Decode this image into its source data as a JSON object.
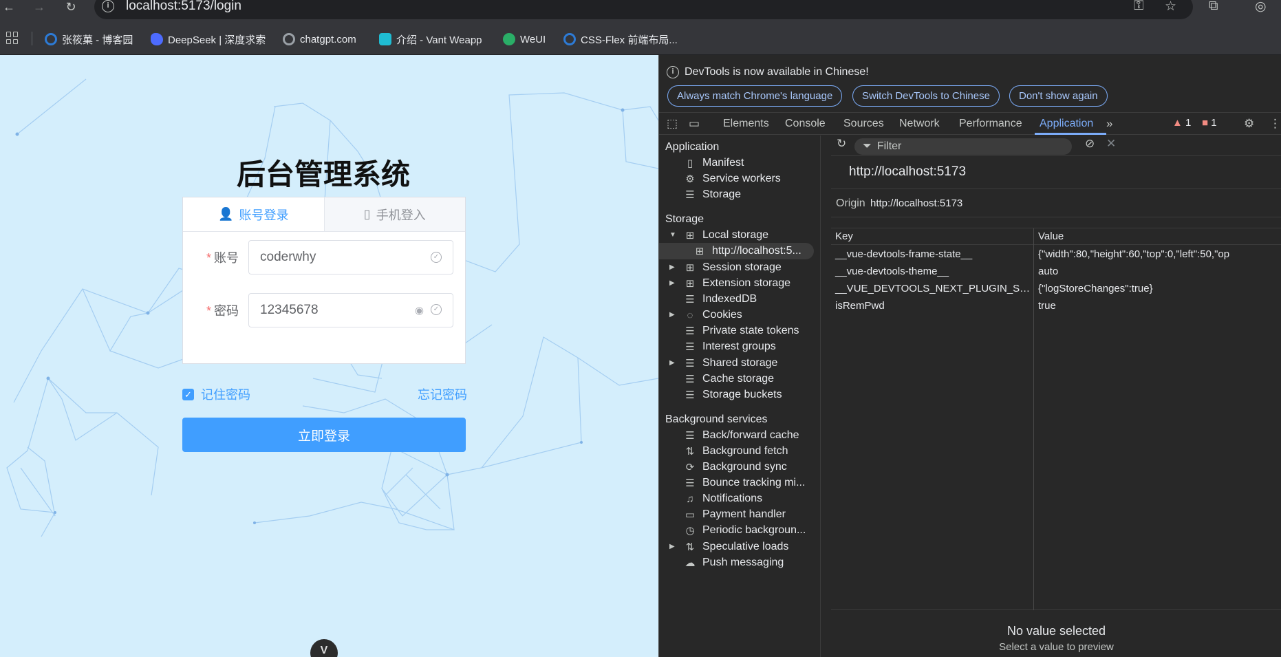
{
  "browser": {
    "url": "localhost:5173/login",
    "bookmarks": [
      {
        "label": "张筱菓 - 博客园",
        "color": "#2d7bd6"
      },
      {
        "label": "DeepSeek | 深度求索",
        "color": "#4d6bfe"
      },
      {
        "label": "chatgpt.com",
        "color": "#9aa0a6"
      },
      {
        "label": "介绍 - Vant Weapp",
        "color": "#1fbcd2"
      },
      {
        "label": "WeUI",
        "color": "#2aae67"
      },
      {
        "label": "CSS-Flex 前端布局...",
        "color": "#2d7bd6"
      }
    ]
  },
  "login": {
    "title": "后台管理系统",
    "tab_account": "账号登录",
    "tab_phone": "手机登入",
    "account_label": "账号",
    "account_value": "coderwhy",
    "password_label": "密码",
    "password_value": "12345678",
    "required_mark": "*",
    "remember_label": "记住密码",
    "remember_checked": true,
    "forgot_label": "忘记密码",
    "login_button": "立即登录",
    "accent_color": "#409eff"
  },
  "devtools": {
    "notice": {
      "text": "DevTools is now available in Chinese!",
      "btn_match": "Always match Chrome's language",
      "btn_switch": "Switch DevTools to Chinese",
      "btn_dismiss": "Don't show again"
    },
    "tabs": [
      "Elements",
      "Console",
      "Sources",
      "Network",
      "Performance",
      "Application"
    ],
    "active_tab": "Application",
    "warnings": "1",
    "errors": "1",
    "sidebar": {
      "section_application": "Application",
      "manifest": "Manifest",
      "service_workers": "Service workers",
      "storage_item": "Storage",
      "section_storage": "Storage",
      "local_storage": "Local storage",
      "local_storage_origin": "http://localhost:5...",
      "session_storage": "Session storage",
      "extension_storage": "Extension storage",
      "indexeddb": "IndexedDB",
      "cookies": "Cookies",
      "private_state_tokens": "Private state tokens",
      "interest_groups": "Interest groups",
      "shared_storage": "Shared storage",
      "cache_storage": "Cache storage",
      "storage_buckets": "Storage buckets",
      "section_background": "Background services",
      "bf_cache": "Back/forward cache",
      "bg_fetch": "Background fetch",
      "bg_sync": "Background sync",
      "bounce_tracking": "Bounce tracking mi...",
      "notifications": "Notifications",
      "payment_handler": "Payment handler",
      "periodic_bg": "Periodic backgroun...",
      "speculative_loads": "Speculative loads",
      "push_messaging": "Push messaging"
    },
    "main": {
      "filter_placeholder": "Filter",
      "origin_heading": "http://localhost:5173",
      "origin_label": "Origin",
      "origin_value": "http://localhost:5173",
      "col_key": "Key",
      "col_value": "Value",
      "rows": [
        {
          "key": "__vue-devtools-frame-state__",
          "value": "{\"width\":80,\"height\":60,\"top\":0,\"left\":50,\"op"
        },
        {
          "key": "__vue-devtools-theme__",
          "value": "auto"
        },
        {
          "key": "__VUE_DEVTOOLS_NEXT_PLUGIN_SETTINGS...",
          "value": "{\"logStoreChanges\":true}"
        },
        {
          "key": "isRemPwd",
          "value": "true"
        }
      ],
      "preview_title": "No value selected",
      "preview_sub": "Select a value to preview"
    }
  }
}
